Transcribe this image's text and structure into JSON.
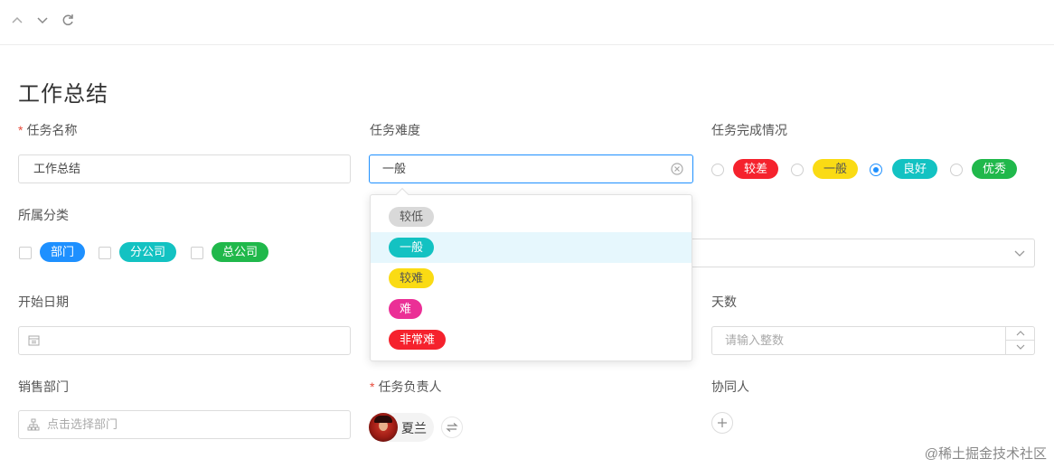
{
  "toolbar": {
    "up_icon": "chevron-up-icon",
    "down_icon": "chevron-down-icon",
    "refresh_icon": "refresh-icon"
  },
  "page_title": "工作总结",
  "task_name": {
    "label": "任务名称",
    "required_mark": "*",
    "value": "工作总结"
  },
  "task_difficulty": {
    "label": "任务难度",
    "value": "一般",
    "options": [
      {
        "label": "较低",
        "color": "#d9d9d9",
        "text_color": "#555555"
      },
      {
        "label": "一般",
        "color": "#13c2c2",
        "text_color": "#ffffff"
      },
      {
        "label": "较难",
        "color": "#fadb14",
        "text_color": "#555555"
      },
      {
        "label": "难",
        "color": "#eb2f96",
        "text_color": "#ffffff"
      },
      {
        "label": "非常难",
        "color": "#f5222d",
        "text_color": "#ffffff"
      }
    ]
  },
  "task_completion": {
    "label": "任务完成情况",
    "selected": "良好",
    "options": [
      {
        "label": "较差",
        "color": "#f5222d",
        "text_color": "#ffffff"
      },
      {
        "label": "一般",
        "color": "#fadb14",
        "text_color": "#555555"
      },
      {
        "label": "良好",
        "color": "#13c2c2",
        "text_color": "#ffffff"
      },
      {
        "label": "优秀",
        "color": "#20b84b",
        "text_color": "#ffffff"
      }
    ]
  },
  "category": {
    "label": "所属分类",
    "options": [
      {
        "label": "部门",
        "color": "#1e90ff"
      },
      {
        "label": "分公司",
        "color": "#13c2c2"
      },
      {
        "label": "总公司",
        "color": "#20b84b"
      }
    ]
  },
  "start_date": {
    "label": "开始日期"
  },
  "days": {
    "label": "天数",
    "placeholder": "请输入整数"
  },
  "sales_dept": {
    "label": "销售部门",
    "placeholder": "点击选择部门"
  },
  "owner": {
    "label": "任务负责人",
    "required_mark": "*",
    "name": "夏兰"
  },
  "collaborators": {
    "label": "协同人"
  },
  "watermark": "@稀土掘金技术社区"
}
